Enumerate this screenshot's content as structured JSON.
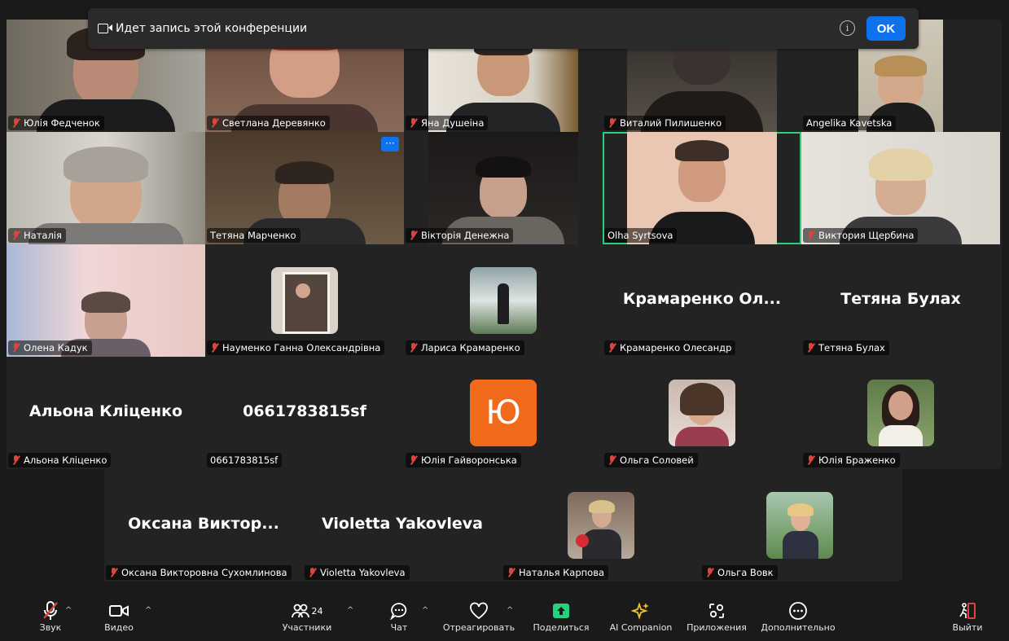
{
  "banner": {
    "text": "Идет запись этой конференции",
    "info": "i",
    "ok": "OK"
  },
  "tiles": [
    {
      "name": "Юлія Федченок"
    },
    {
      "name": "Светлана Деревянко"
    },
    {
      "name": "Яна Душеіна"
    },
    {
      "name": "Виталий Пилишенко"
    },
    {
      "name": "Angelika  Kavetska"
    },
    {
      "name": "Наталія"
    },
    {
      "name": "Тетяна Марченко"
    },
    {
      "name": "Вікторія Денежна"
    },
    {
      "name": "Olha Syrtsova"
    },
    {
      "name": "Виктория Щербина"
    },
    {
      "name": "Олена Кадук"
    },
    {
      "name": "Науменко Ганна Олександрівна"
    },
    {
      "name": "Лариса Крамаренко"
    },
    {
      "name": "Крамаренко Олесандр",
      "big": "Крамаренко  Ол..."
    },
    {
      "name": "Тетяна Булах",
      "big": "Тетяна Булах"
    },
    {
      "name": "Альона Кліценко",
      "big": "Альона Кліценко"
    },
    {
      "name": "0661783815sf",
      "big": "0661783815sf"
    },
    {
      "name": "Юлія Гайворонська",
      "initial": "Ю"
    },
    {
      "name": "Ольга Соловей"
    },
    {
      "name": "Юлія Браженко"
    },
    {
      "name": "Оксана Викторовна Сухомлинова",
      "big": "Оксана  Виктор..."
    },
    {
      "name": "Violetta Yakovleva",
      "big": "Violetta Yakovleva"
    },
    {
      "name": "Наталья Карпова"
    },
    {
      "name": "Ольга Вовк"
    }
  ],
  "dots": "···",
  "toolbar": {
    "sound": "Звук",
    "video": "Видео",
    "participants": "Участники",
    "participants_count": "24",
    "chat": "Чат",
    "react": "Отреагировать",
    "share": "Поделиться",
    "ai": "AI Companion",
    "apps": "Приложения",
    "more": "Дополнительно",
    "leave": "Выйти",
    "caret": "^"
  },
  "colors": {
    "accent": "#0e72ed",
    "share": "#26d07c",
    "muted": "#e0433b",
    "initial_bg": "#f26a1b"
  }
}
